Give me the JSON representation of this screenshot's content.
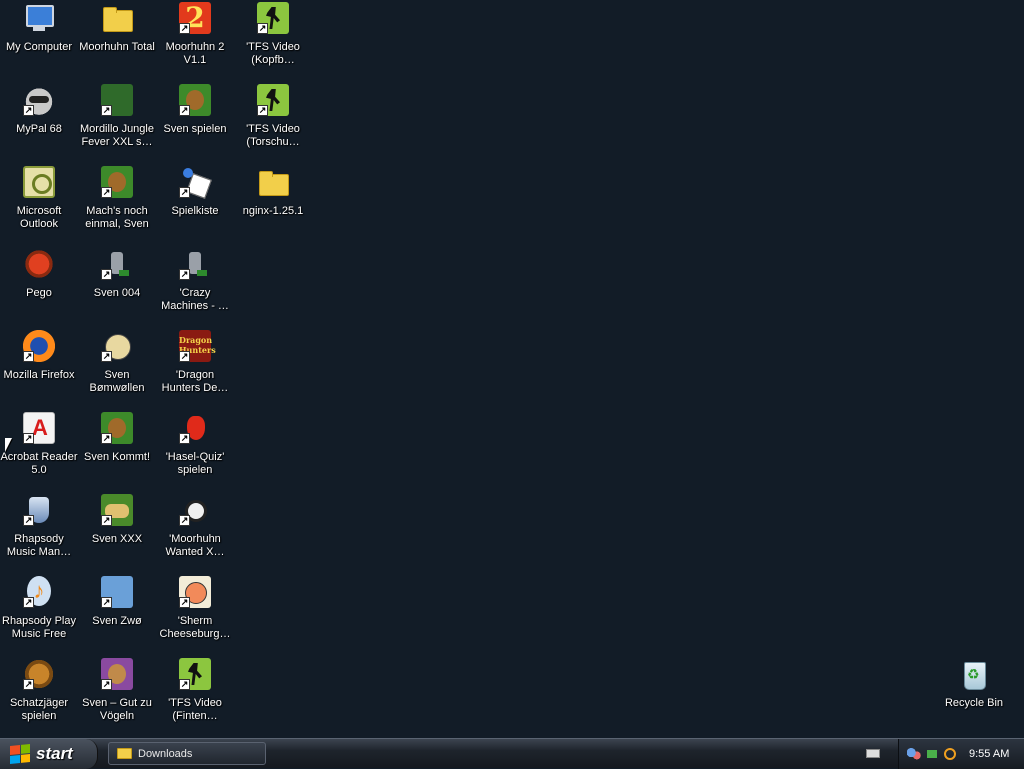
{
  "desktop": {
    "icons": [
      {
        "label": "My Computer",
        "icon": "my-computer-icon"
      },
      {
        "label": "MyPal 68",
        "icon": "mypal-icon"
      },
      {
        "label": "Microsoft Outlook",
        "icon": "outlook-icon"
      },
      {
        "label": "Pego",
        "icon": "pego-icon"
      },
      {
        "label": "Mozilla Firefox",
        "icon": "firefox-icon"
      },
      {
        "label": "Acrobat Reader 5.0",
        "icon": "acrobat-icon"
      },
      {
        "label": "Rhapsody Music Man…",
        "icon": "rhapsody-icon"
      },
      {
        "label": "Rhapsody Play Music Free",
        "icon": "rhapsody-play-icon"
      },
      {
        "label": "Schatzjäger spielen",
        "icon": "schatzjaeger-icon"
      },
      {
        "label": "Moorhuhn Total",
        "icon": "folder-icon"
      },
      {
        "label": "Mordillo Jungle Fever XXL s…",
        "icon": "mordillo-icon"
      },
      {
        "label": "Mach's noch einmal, Sven",
        "icon": "sven-icon"
      },
      {
        "label": "Sven 004",
        "icon": "sven-004-icon"
      },
      {
        "label": "Sven Bømwøllen",
        "icon": "sven-bomwollen-icon"
      },
      {
        "label": "Sven Kommt!",
        "icon": "sven-kommt-icon"
      },
      {
        "label": "Sven XXX",
        "icon": "sven-xxx-icon"
      },
      {
        "label": "Sven Zwø",
        "icon": "sven-zwo-icon"
      },
      {
        "label": "Sven – Gut zu Vögeln",
        "icon": "sven-gut-icon"
      },
      {
        "label": "Moorhuhn 2 V1.1",
        "icon": "moorhuhn-2-icon"
      },
      {
        "label": "Sven spielen",
        "icon": "sven-spielen-icon"
      },
      {
        "label": "Spielkiste",
        "icon": "spielkiste-icon"
      },
      {
        "label": "'Crazy Machines - …",
        "icon": "crazy-machines-icon"
      },
      {
        "label": "'Dragon Hunters De…",
        "icon": "dragon-hunters-icon"
      },
      {
        "label": "'Hasel-Quiz' spielen",
        "icon": "hasel-quiz-icon"
      },
      {
        "label": "'Moorhuhn Wanted X…",
        "icon": "moorhuhn-wanted-icon"
      },
      {
        "label": "'Sherm Cheeseburg…",
        "icon": "sherm-icon"
      },
      {
        "label": "'TFS Video (Finten…",
        "icon": "tfs-video-icon"
      },
      {
        "label": "'TFS Video (Kopfb…",
        "icon": "tfs-video-icon"
      },
      {
        "label": "'TFS Video (Torschu…",
        "icon": "tfs-video-icon"
      },
      {
        "label": "nginx-1.25.1",
        "icon": "folder-icon"
      },
      {
        "label": "Recycle Bin",
        "icon": "recycle-bin-icon"
      }
    ],
    "dragon_hunters_icon_text": "Dragon Hunters",
    "moorhuhn2_icon_text": "2"
  },
  "taskbar": {
    "start_label": "start",
    "window_button_label": "Downloads",
    "clock": "9:55 AM"
  },
  "colors": {
    "desktop_background": "#121c27",
    "taskbar": "#1e242c"
  }
}
